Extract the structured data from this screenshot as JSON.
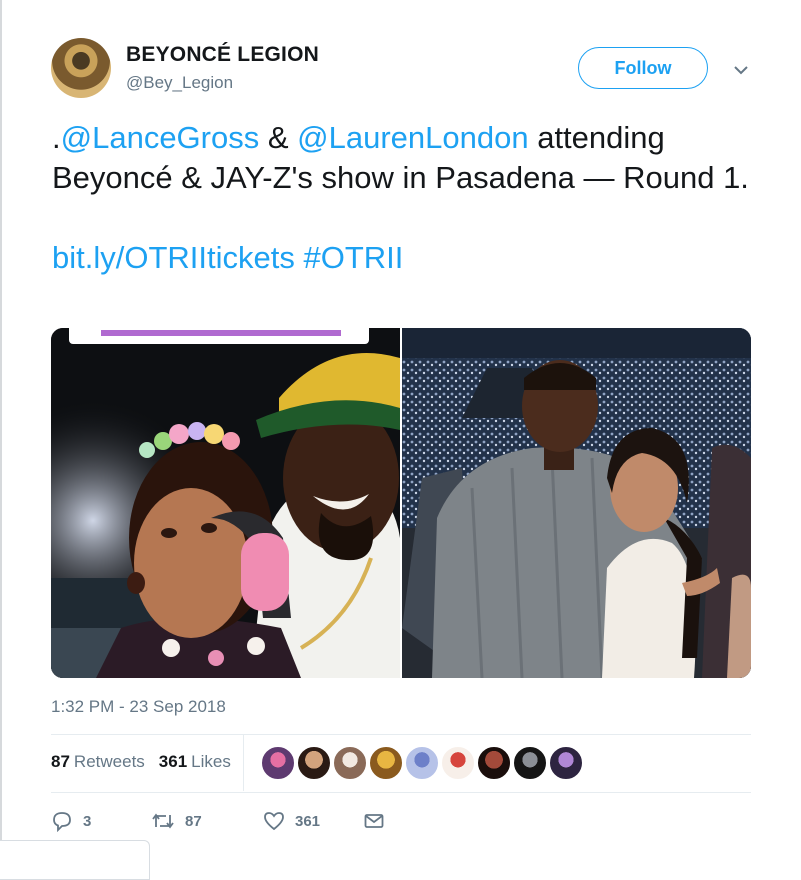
{
  "tweet": {
    "author": {
      "name": "BEYONCÉ LEGION",
      "handle": "@Bey_Legion",
      "avatar_icon": "profile-photo"
    },
    "follow_label": "Follow",
    "text": {
      "lead": ".",
      "mention1": "@LanceGross",
      "amp": " & ",
      "mention2": "@LaurenLondon",
      "rest": " attending Beyoncé & JAY-Z's show in Pasadena — Round 1.",
      "link": "bit.ly/OTRIItickets",
      "hashtag": "#OTRII"
    },
    "photos": [
      "concert-selfie-photo",
      "couple-in-stadium-photo"
    ],
    "timestamp": "1:32 PM - 23 Sep 2018",
    "stats": {
      "retweets": "87",
      "retweets_label": "Retweets",
      "likes": "361",
      "likes_label": "Likes"
    },
    "likers_count_shown": 9,
    "actions": {
      "replies": "3",
      "retweets": "87",
      "likes": "361"
    }
  },
  "colors": {
    "brand_blue": "#1da1f2",
    "secondary_text": "#657786",
    "divider": "#e6ecf0"
  }
}
